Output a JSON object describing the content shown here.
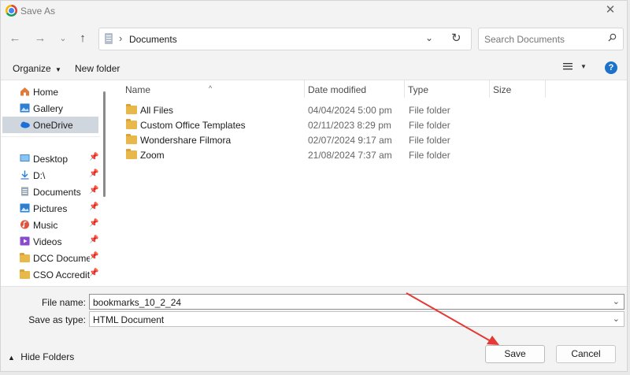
{
  "window": {
    "title": "Save As"
  },
  "nav": {
    "address_path": "Documents",
    "search_placeholder": "Search Documents"
  },
  "toolbar": {
    "organize_label": "Organize",
    "new_folder_label": "New folder"
  },
  "sidebar": {
    "items": [
      {
        "label": "Home",
        "icon": "home-icon"
      },
      {
        "label": "Gallery",
        "icon": "gallery-icon"
      },
      {
        "label": "OneDrive",
        "icon": "cloud-icon",
        "selected": true
      },
      {
        "label": "Desktop",
        "icon": "desktop-icon",
        "pinned": true
      },
      {
        "label": "D:\\",
        "icon": "download-icon",
        "pinned": true
      },
      {
        "label": "Documents",
        "icon": "document-icon",
        "pinned": true
      },
      {
        "label": "Pictures",
        "icon": "pictures-icon",
        "pinned": true
      },
      {
        "label": "Music",
        "icon": "music-icon",
        "pinned": true
      },
      {
        "label": "Videos",
        "icon": "videos-icon",
        "pinned": true
      },
      {
        "label": "DCC Documen",
        "icon": "folder-icon",
        "pinned": true
      },
      {
        "label": "CSO Accredita",
        "icon": "folder-icon",
        "pinned": true
      }
    ]
  },
  "files": {
    "columns": {
      "name": "Name",
      "date": "Date modified",
      "type": "Type",
      "size": "Size"
    },
    "rows": [
      {
        "name": "All Files",
        "date": "04/04/2024 5:00 pm",
        "type": "File folder"
      },
      {
        "name": "Custom Office Templates",
        "date": "02/11/2023 8:29 pm",
        "type": "File folder"
      },
      {
        "name": "Wondershare Filmora",
        "date": "02/07/2024 9:17 am",
        "type": "File folder"
      },
      {
        "name": "Zoom",
        "date": "21/08/2024 7:37 am",
        "type": "File folder"
      }
    ]
  },
  "form": {
    "file_name_label": "File name:",
    "file_name_value": "bookmarks_10_2_24",
    "save_type_label": "Save as type:",
    "save_type_value": "HTML Document",
    "hide_folders_label": "Hide Folders",
    "save_label": "Save",
    "cancel_label": "Cancel"
  },
  "colors": {
    "accent": "#1a73c9",
    "annotation_arrow": "#e53935",
    "folder": "#e8b84a"
  }
}
